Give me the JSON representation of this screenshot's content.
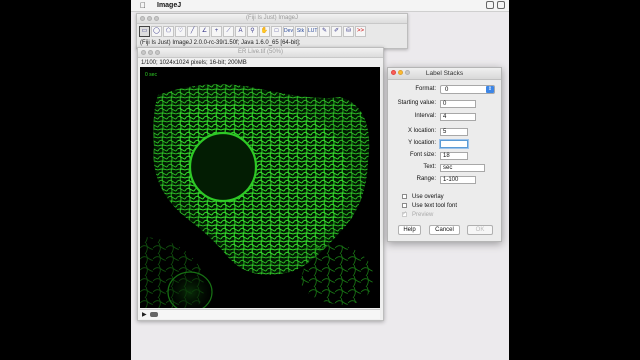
{
  "menubar": {
    "app_name": "ImageJ"
  },
  "imagej": {
    "title": "(Fiji Is Just) ImageJ",
    "status": "(Fiji Is Just) ImageJ 2.0.0-rc-39/1.50f; Java 1.6.0_65 [64-bit];",
    "tools": [
      "rectangle",
      "oval",
      "polygon",
      "freehand",
      "straight-line",
      "angle",
      "point",
      "wand",
      "text",
      "magnifier",
      "hand",
      "color-picker",
      "Dev",
      "Stk",
      "LUT",
      "pencil",
      "brush",
      "flood-fill",
      "more"
    ],
    "tool_labels": {
      "dev": "Dev",
      "stk": "Stk",
      "lut": "LUT",
      "more": ">>"
    }
  },
  "image_window": {
    "title": "ER Live.tif (50%)",
    "info": "1/100; 1024x1024 pixels; 16-bit; 200MB",
    "canvas_label": "0 sec"
  },
  "dialog": {
    "title": "Label Stacks",
    "format_label": "Format:",
    "format_value": "0",
    "starting_value_label": "Starting value:",
    "starting_value": "0",
    "interval_label": "Interval:",
    "interval": "4",
    "x_location_label": "X location:",
    "x_location": "5",
    "y_location_label": "Y location:",
    "y_location": "",
    "font_size_label": "Font size:",
    "font_size": "18",
    "text_label": "Text:",
    "text_value": "sec",
    "range_label": "Range:",
    "range_value": "1-100",
    "use_overlay": "Use overlay",
    "use_text_tool_font": "Use text tool font",
    "preview": "Preview",
    "help_button": "Help",
    "cancel_button": "Cancel",
    "ok_button": "OK"
  },
  "colors": {
    "accent": "#3d86e6",
    "signal": "#22c81e"
  }
}
